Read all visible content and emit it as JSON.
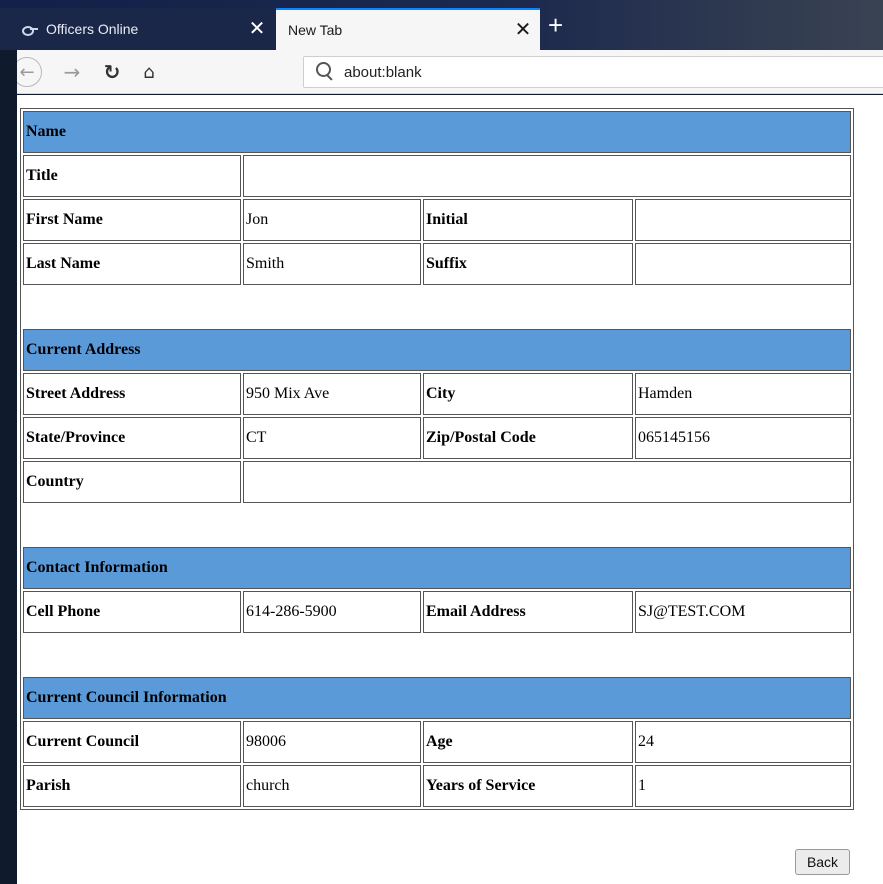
{
  "browser": {
    "tabs": [
      {
        "label": "Officers Online",
        "close": "✕",
        "active": false
      },
      {
        "label": "New Tab",
        "close": "✕",
        "active": true
      }
    ],
    "new_tab": "+",
    "address": "about:blank"
  },
  "form": {
    "name": {
      "header": "Name",
      "title_label": "Title",
      "title_value": "",
      "first_label": "First Name",
      "first_value": "Jon",
      "initial_label": "Initial",
      "initial_value": "",
      "last_label": "Last Name",
      "last_value": "Smith",
      "suffix_label": "Suffix",
      "suffix_value": ""
    },
    "address": {
      "header": "Current Address",
      "street_label": "Street Address",
      "street_value": "950 Mix Ave",
      "city_label": "City",
      "city_value": "Hamden",
      "state_label": "State/Province",
      "state_value": "CT",
      "zip_label": "Zip/Postal Code",
      "zip_value": "065145156",
      "country_label": "Country",
      "country_value": ""
    },
    "contact": {
      "header": "Contact Information",
      "cell_label": "Cell Phone",
      "cell_value": "614-286-5900",
      "email_label": "Email Address",
      "email_value": "SJ@TEST.COM"
    },
    "council": {
      "header": "Current Council Information",
      "council_label": "Current Council",
      "council_value": "98006",
      "age_label": "Age",
      "age_value": "24",
      "parish_label": "Parish",
      "parish_value": "church",
      "years_label": "Years of Service",
      "years_value": "1"
    }
  },
  "back_label": "Back",
  "colors": {
    "section_header": "#5b9ad9",
    "active_tab_accent": "#0a84ff"
  }
}
